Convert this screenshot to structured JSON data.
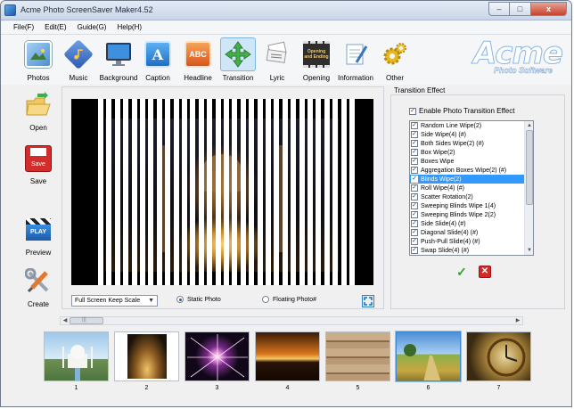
{
  "window": {
    "title": "Acme Photo ScreenSaver Maker4.52",
    "min_label": "–",
    "max_label": "□",
    "close_label": "x"
  },
  "menu": [
    "File(F)",
    "Edit(E)",
    "Guide(G)",
    "Help(H)"
  ],
  "toolbar": {
    "items": [
      {
        "label": "Photos",
        "icon": "photos-icon",
        "color": "#4a8fd6"
      },
      {
        "label": "Music",
        "icon": "music-icon",
        "color": "#3b6fc4"
      },
      {
        "label": "Background",
        "icon": "monitor-icon",
        "color": "#2f7cd4"
      },
      {
        "label": "Caption",
        "icon": "caption-icon",
        "color": "#2d89d8",
        "glyph": "A"
      },
      {
        "label": "Headline",
        "icon": "headline-icon",
        "color": "#e2712a",
        "glyph": "ABC"
      },
      {
        "label": "Transition",
        "icon": "transition-icon",
        "color": "#45b04a"
      },
      {
        "label": "Lyric",
        "icon": "lyric-icon",
        "color": "#c8c8c8"
      },
      {
        "label": "Opening",
        "icon": "film-icon",
        "color": "#3a3a3a",
        "glyph": "Opening and Ending"
      },
      {
        "label": "Information",
        "icon": "notepad-icon",
        "color": "#5aa0d8"
      },
      {
        "label": "Other",
        "icon": "gears-icon",
        "color": "#e6b422"
      }
    ],
    "active": "Transition"
  },
  "logo": {
    "main": "Acme",
    "sub": "Photo Software"
  },
  "sidebar": [
    {
      "label": "Open",
      "icon": "open-folder-icon"
    },
    {
      "label": "Save",
      "icon": "save-disk-icon",
      "glyph": "Save"
    },
    {
      "label": "Preview",
      "icon": "clapperboard-icon",
      "glyph": "PLAY"
    },
    {
      "label": "Create",
      "icon": "tools-icon"
    }
  ],
  "preview": {
    "scale_option": "Full Screen Keep Scale",
    "static_label": "Static Photo",
    "floating_label": "Floating Photo#",
    "mode": "Static Photo"
  },
  "effect": {
    "title": "Transition Effect",
    "enable_label": "Enable Photo Transition Effect",
    "enabled": true,
    "items": [
      "Random Line Wipe(2)",
      "Side Wipe(4) (#)",
      "Both Sides Wipe(2) (#)",
      "Box Wipe(2)",
      "Boxes Wipe",
      "Aggregation Boxes Wipe(2) (#)",
      "Blinds Wipe(2)",
      "Roll Wipe(4) (#)",
      "Scatter Rotation(2)",
      "Sweeping Blinds Wipe 1(4)",
      "Sweeping Blinds Wipe 2(2)",
      "Side Slide(4) (#)",
      "Diagonal Slide(4) (#)",
      "Push-Pull Slide(4) (#)",
      "Swap Slide(4) (#)"
    ],
    "selected": "Blinds Wipe(2)",
    "check_mark": "✓",
    "ok_label": "✓",
    "cancel_label": "✕"
  },
  "thumbnails": [
    {
      "num": "1",
      "subject": "taj-mahal"
    },
    {
      "num": "2",
      "subject": "night-temple"
    },
    {
      "num": "3",
      "subject": "fireworks"
    },
    {
      "num": "4",
      "subject": "sunset"
    },
    {
      "num": "5",
      "subject": "wood-planks"
    },
    {
      "num": "6",
      "subject": "field-path"
    },
    {
      "num": "7",
      "subject": "clock"
    }
  ],
  "selected_thumbnail": "6",
  "scroll": {
    "up": "▲",
    "down": "▼",
    "left": "◀",
    "right": "▶",
    "grip": "|||"
  }
}
